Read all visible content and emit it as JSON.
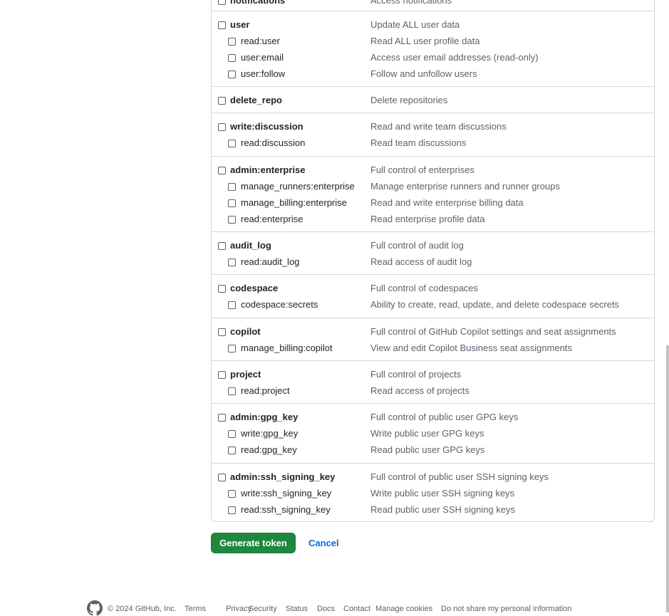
{
  "scopes": [
    {
      "items": [
        {
          "name": "notifications",
          "desc": "Access notifications"
        }
      ]
    },
    {
      "items": [
        {
          "name": "user",
          "desc": "Update ALL user data"
        },
        {
          "name": "read:user",
          "desc": "Read ALL user profile data"
        },
        {
          "name": "user:email",
          "desc": "Access user email addresses (read-only)"
        },
        {
          "name": "user:follow",
          "desc": "Follow and unfollow users"
        }
      ]
    },
    {
      "items": [
        {
          "name": "delete_repo",
          "desc": "Delete repositories"
        }
      ]
    },
    {
      "items": [
        {
          "name": "write:discussion",
          "desc": "Read and write team discussions"
        },
        {
          "name": "read:discussion",
          "desc": "Read team discussions"
        }
      ]
    },
    {
      "items": [
        {
          "name": "admin:enterprise",
          "desc": "Full control of enterprises"
        },
        {
          "name": "manage_runners:enterprise",
          "desc": "Manage enterprise runners and runner groups"
        },
        {
          "name": "manage_billing:enterprise",
          "desc": "Read and write enterprise billing data"
        },
        {
          "name": "read:enterprise",
          "desc": "Read enterprise profile data"
        }
      ]
    },
    {
      "items": [
        {
          "name": "audit_log",
          "desc": "Full control of audit log"
        },
        {
          "name": "read:audit_log",
          "desc": "Read access of audit log"
        }
      ]
    },
    {
      "items": [
        {
          "name": "codespace",
          "desc": "Full control of codespaces"
        },
        {
          "name": "codespace:secrets",
          "desc": "Ability to create, read, update, and delete codespace secrets"
        }
      ]
    },
    {
      "items": [
        {
          "name": "copilot",
          "desc": "Full control of GitHub Copilot settings and seat assignments"
        },
        {
          "name": "manage_billing:copilot",
          "desc": "View and edit Copilot Business seat assignments"
        }
      ]
    },
    {
      "items": [
        {
          "name": "project",
          "desc": "Full control of projects"
        },
        {
          "name": "read:project",
          "desc": "Read access of projects"
        }
      ]
    },
    {
      "items": [
        {
          "name": "admin:gpg_key",
          "desc": "Full control of public user GPG keys"
        },
        {
          "name": "write:gpg_key",
          "desc": "Write public user GPG keys"
        },
        {
          "name": "read:gpg_key",
          "desc": "Read public user GPG keys"
        }
      ]
    },
    {
      "items": [
        {
          "name": "admin:ssh_signing_key",
          "desc": "Full control of public user SSH signing keys"
        },
        {
          "name": "write:ssh_signing_key",
          "desc": "Write public user SSH signing keys"
        },
        {
          "name": "read:ssh_signing_key",
          "desc": "Read public user SSH signing keys"
        }
      ]
    }
  ],
  "actions": {
    "generate_label": "Generate token",
    "cancel_label": "Cancel"
  },
  "footer": {
    "copyright": "© 2024 GitHub, Inc.",
    "links": [
      "Terms",
      "Privacy",
      "Security",
      "Status",
      "Docs",
      "Contact",
      "Manage cookies",
      "Do not share my personal information"
    ]
  },
  "colors": {
    "primary_button": "#1f883d",
    "link": "#0969da",
    "border": "#d0d7de",
    "muted_text": "#59636e"
  }
}
